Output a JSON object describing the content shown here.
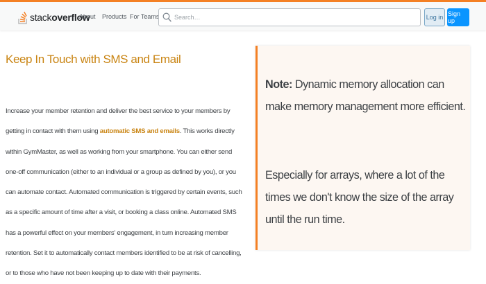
{
  "header": {
    "logo": {
      "prefix": "stack",
      "bold": "overflow"
    },
    "nav": [
      "About",
      "Products",
      "For Teams"
    ],
    "search": {
      "placeholder": "Search…",
      "value": ""
    },
    "login_label": "Log in",
    "signup_label": "Sign up",
    "colors": {
      "accent": "#f48024",
      "primary": "#0a95ff"
    }
  },
  "article": {
    "heading": "Keep In Touch with SMS and Email",
    "p_before": "Increase your member retention and deliver the best service to your members by getting in contact with them using ",
    "highlight": "automatic SMS and emails",
    "p_after": ". This works directly within GymMaster, as well as working from your smartphone. You can either send one-off communication (either to an individual or a group as defined by you), or you can automate contact. Automated communication is triggered by certain events, such as a specific amount of time after a visit, or booking a class online. Automated SMS has a powerful effect on your members' engagement, in turn increasing member retention. Set it to automatically contact members identified to be at risk of cancelling, or to those who have not been keeping up to date with their payments."
  },
  "note": {
    "label": "Note:",
    "text1": " Dynamic memory allocation can make memory management more efficient.",
    "text2": "Especially for arrays, where a lot of the times we don't know the size of the array until the run time."
  }
}
